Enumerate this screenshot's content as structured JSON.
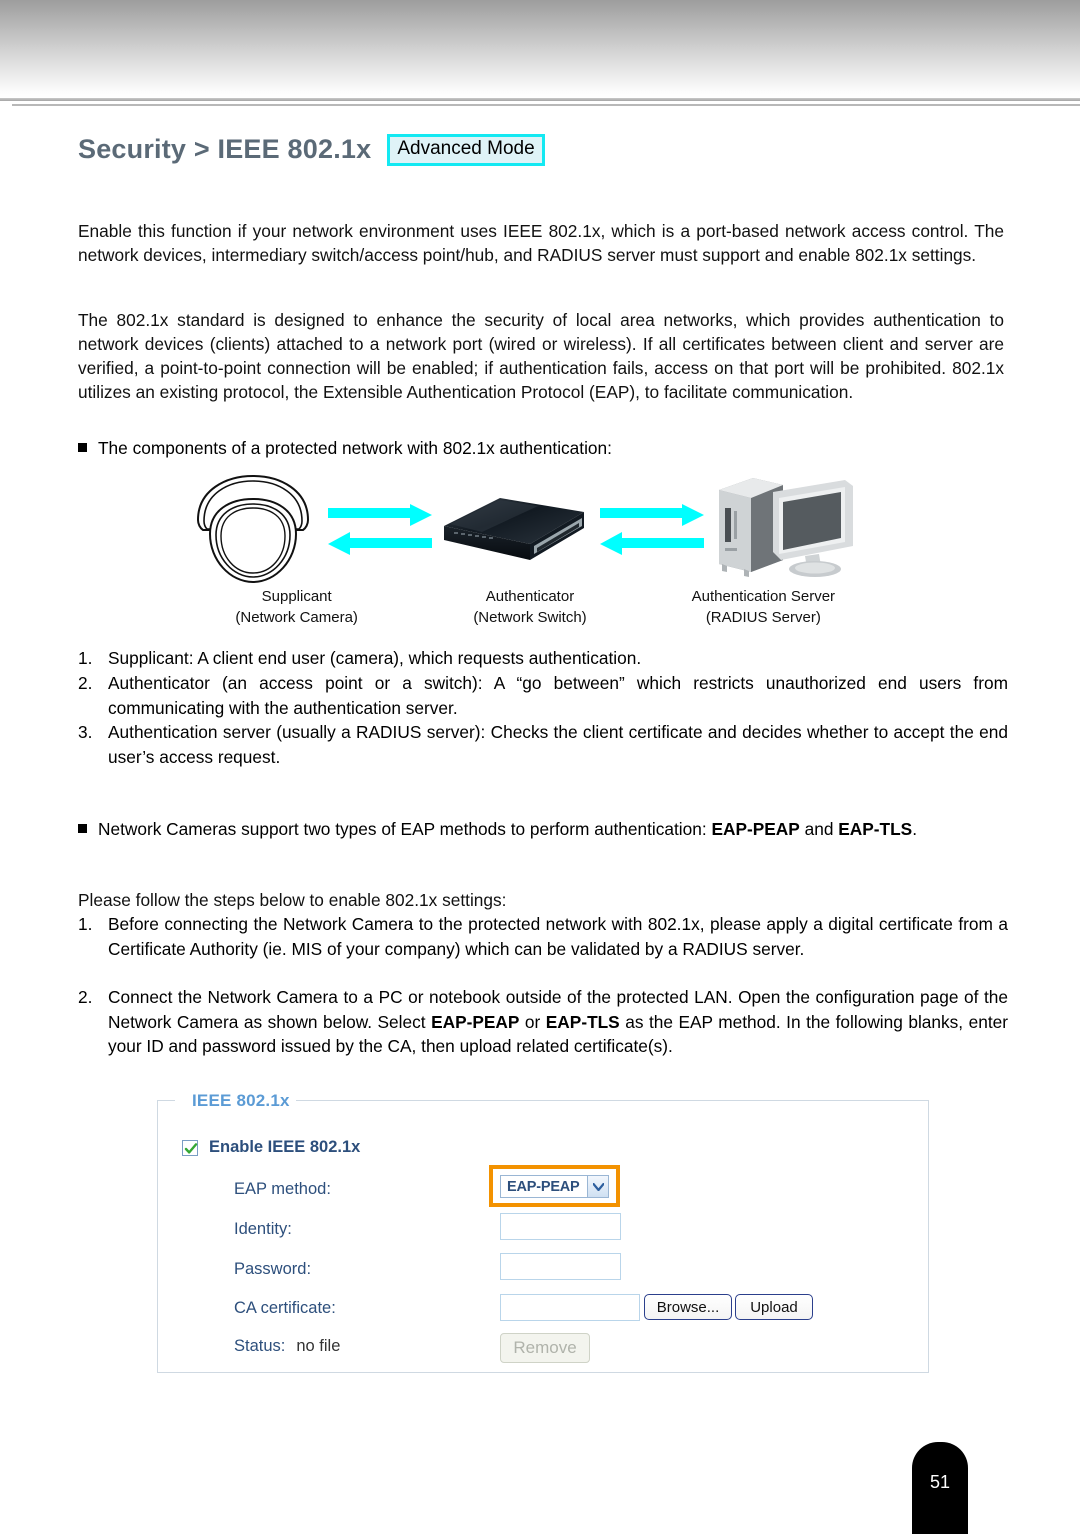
{
  "page": {
    "number": "51",
    "title_main": "Security > IEEE 802.1x",
    "title_badge": "Advanced Mode"
  },
  "intro": {
    "paragraph_1": "Enable this function if your network environment uses IEEE 802.1x, which is a port-based network access control. The network devices, intermediary switch/access point/hub, and RADIUS server must support and enable 802.1x settings.",
    "paragraph_2": "The 802.1x standard is designed to enhance the security of local area networks, which provides authentication to network devices (clients) attached to a network port (wired or wireless). If all certificates between client and server are verified, a point-to-point connection will be enabled; if authentication fails, access on that port will be prohibited. 802.1x utilizes an existing protocol, the Extensible Authentication Protocol (EAP), to facilitate communication."
  },
  "components_bullet": "The components of a protected network with 802.1x authentication:",
  "diagram": {
    "arrow_color": "#00ffff",
    "nodes": [
      {
        "icon": "dome-camera-icon",
        "title": "Supplicant",
        "subtitle": "(Network Camera)"
      },
      {
        "icon": "network-switch-icon",
        "title": "Authenticator",
        "subtitle": "(Network Switch)"
      },
      {
        "icon": "server-computer-icon",
        "title": "Authentication Server",
        "subtitle": "(RADIUS Server)"
      }
    ]
  },
  "component_list": [
    {
      "marker": "1.",
      "text": "Supplicant: A client end user (camera), which requests authentication."
    },
    {
      "marker": "2.",
      "text": "Authenticator (an access point or a switch): A “go between” which restricts unauthorized end users from communicating with the authentication server."
    },
    {
      "marker": "3.",
      "text": "Authentication server (usually a RADIUS server): Checks the client certificate and decides whether to accept the end user’s access request."
    }
  ],
  "eap_bullet": {
    "lead": "Network Cameras support two types of EAP methods to perform authentication: ",
    "bold_1": "EAP-PEAP",
    "mid": " and ",
    "bold_2": "EAP-TLS",
    "tail": "."
  },
  "steps_intro": "Please follow the steps below to enable 802.1x settings:",
  "steps": [
    {
      "marker": "1.",
      "text": "Before connecting the Network Camera to the protected network with 802.1x, please apply a digital certificate from a Certificate Authority (ie. MIS of your company) which can be validated by a RADIUS server."
    },
    {
      "marker": "2.",
      "part_1": "Connect the Network Camera to a PC or notebook outside of the protected LAN. Open the configuration page of the Network Camera as shown below. Select ",
      "bold_1": "EAP-PEAP",
      "part_2": " or ",
      "bold_2": "EAP-TLS",
      "part_3": " as the EAP method. In the following blanks, enter your ID and password issued by the CA, then upload related certificate(s)."
    }
  ],
  "panel": {
    "legend": "IEEE 802.1x",
    "enable_checkbox_label": "Enable IEEE 802.1x",
    "enable_checked": true,
    "fields": {
      "eap_method_label": "EAP method:",
      "eap_method_value": "EAP-PEAP",
      "identity_label": "Identity:",
      "identity_value": "",
      "password_label": "Password:",
      "password_value": "",
      "ca_certificate_label": "CA certificate:",
      "ca_certificate_value": "",
      "status_label": "Status:",
      "status_value": "no file"
    },
    "buttons": {
      "browse": "Browse...",
      "upload": "Upload",
      "remove": "Remove"
    },
    "colors": {
      "legend_blue": "#5b9bd5",
      "label_blue": "#2d4f7c",
      "highlight_orange": "#f39200",
      "button_border": "#2b3f8c"
    }
  }
}
